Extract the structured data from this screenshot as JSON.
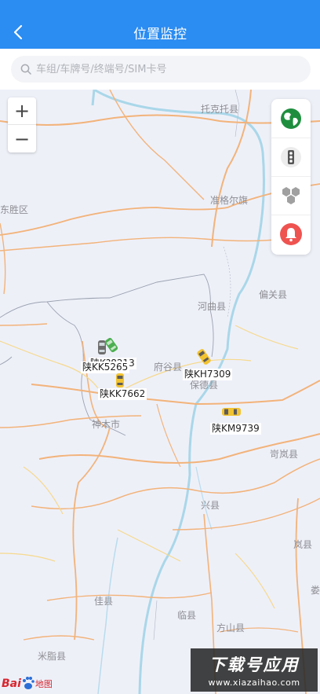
{
  "header": {
    "title": "位置监控"
  },
  "search": {
    "placeholder": "车组/车牌号/终端号/SIM卡号",
    "value": ""
  },
  "zoom": {
    "in_label": "+",
    "out_label": "−"
  },
  "places": [
    "托克托县",
    "准格尔旗",
    "东胜区",
    "偏关县",
    "河曲县",
    "保德县",
    "神木市",
    "府谷县",
    "兴县",
    "岢岚县",
    "佳县",
    "临县",
    "方山县",
    "米脂县",
    "岚县",
    "娄"
  ],
  "vehicles": [
    {
      "plate": "陕KK5265",
      "color": "gray"
    },
    {
      "plate": "陕K?8213",
      "color": "green"
    },
    {
      "plate": "陕KK7662",
      "color": "yellow"
    },
    {
      "plate": "陕KH7309",
      "color": "yellow"
    },
    {
      "plate": "陕KM9739",
      "color": "yellow"
    }
  ],
  "tools": [
    {
      "icon": "globe-icon",
      "color": "#1e8e3e"
    },
    {
      "icon": "traffic-light-icon",
      "color": "#555555"
    },
    {
      "icon": "hexagon-cluster-icon",
      "color": "#9e9e9e"
    },
    {
      "icon": "alarm-bell-icon",
      "color": "#ef5350"
    }
  ],
  "map_logo": {
    "text": "Bai地图"
  },
  "watermark": {
    "main": "下载号应用",
    "sub": "www.xiazaihao.com"
  }
}
